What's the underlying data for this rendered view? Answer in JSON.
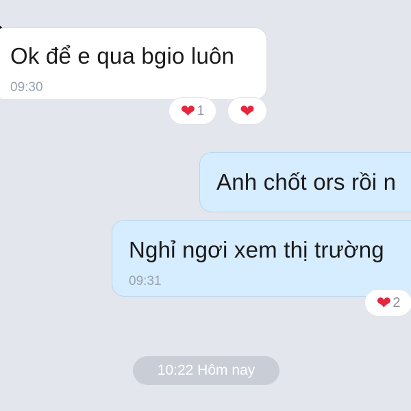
{
  "messages": [
    {
      "direction": "incoming",
      "text": "Ok để e qua bgio luôn",
      "time": "09:30"
    },
    {
      "direction": "outgoing",
      "text": "Anh chốt ors rồi n",
      "time": ""
    },
    {
      "direction": "outgoing",
      "text": "Nghỉ ngơi xem thị trường",
      "time": "09:31"
    }
  ],
  "reactions": [
    {
      "icon": "heart-icon",
      "glyph": "❤",
      "count": "1"
    },
    {
      "icon": "heart-icon",
      "glyph": "❤",
      "count": ""
    },
    {
      "icon": "heart-icon",
      "glyph": "❤",
      "count": "2"
    }
  ],
  "date_separator": "10:22 Hôm nay",
  "colors": {
    "background": "#e3e6ec",
    "incoming_bubble": "#ffffff",
    "outgoing_bubble": "#d6ecff",
    "heart": "#e8253f",
    "time_text": "#9aa3ad",
    "date_pill": "#c9ced6"
  }
}
